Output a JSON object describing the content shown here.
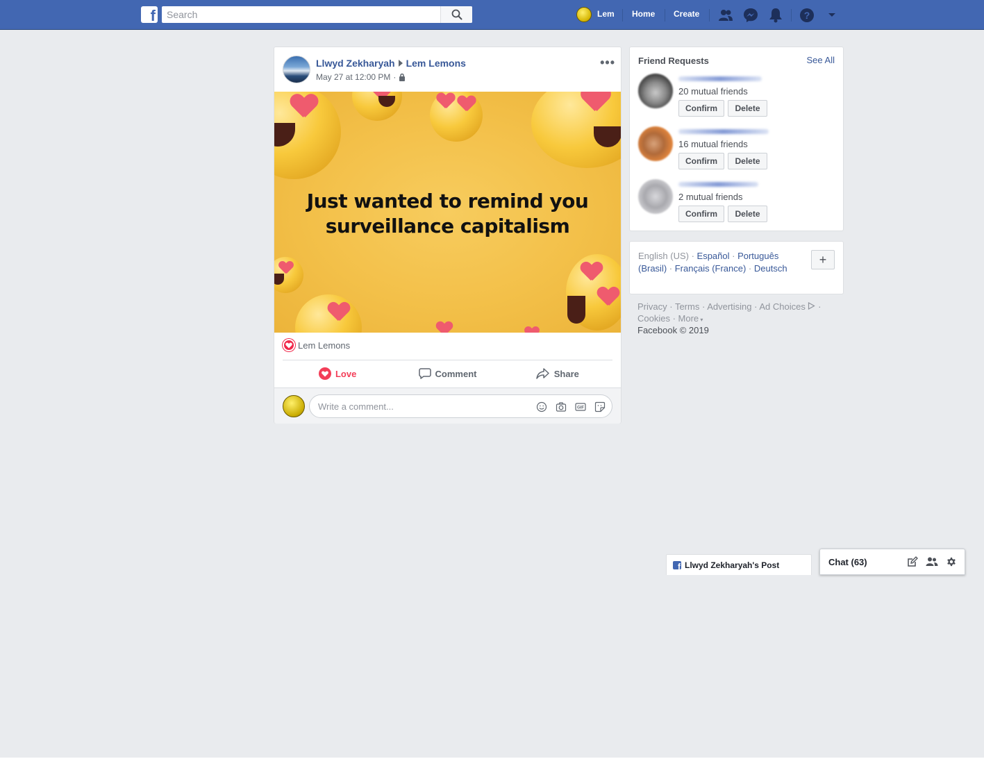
{
  "header": {
    "search_placeholder": "Search",
    "user_name": "Lem",
    "nav_home": "Home",
    "nav_create": "Create",
    "brand_color": "#4267b2"
  },
  "post": {
    "author": "Llwyd Zekharyah",
    "recipient": "Lem Lemons",
    "timestamp": "May 27 at 12:00 PM",
    "separator": "·",
    "image_text_line1": "Just wanted to remind you",
    "image_text_line2": "surveillance capitalism",
    "reactor": "Lem Lemons",
    "actions": {
      "love": "Love",
      "comment": "Comment",
      "share": "Share"
    },
    "comment_placeholder": "Write a comment..."
  },
  "friend_requests": {
    "title": "Friend Requests",
    "see_all": "See All",
    "items": [
      {
        "mutual": "20 mutual friends",
        "confirm": "Confirm",
        "delete": "Delete"
      },
      {
        "mutual": "16 mutual friends",
        "confirm": "Confirm",
        "delete": "Delete"
      },
      {
        "mutual": "2 mutual friends",
        "confirm": "Confirm",
        "delete": "Delete"
      }
    ]
  },
  "languages": {
    "current": "English (US)",
    "espanol": "Español",
    "portugues": "Português (Brasil)",
    "francais": "Français (France)",
    "deutsch": "Deutsch",
    "add": "+"
  },
  "footer": {
    "privacy": "Privacy",
    "terms": "Terms",
    "advertising": "Advertising",
    "ad_choices": "Ad Choices",
    "cookies": "Cookies",
    "more": "More",
    "copyright": "Facebook © 2019"
  },
  "chat": {
    "post_tab_label": "Llwyd Zekharyah's Post",
    "chat_label": "Chat (63)"
  }
}
